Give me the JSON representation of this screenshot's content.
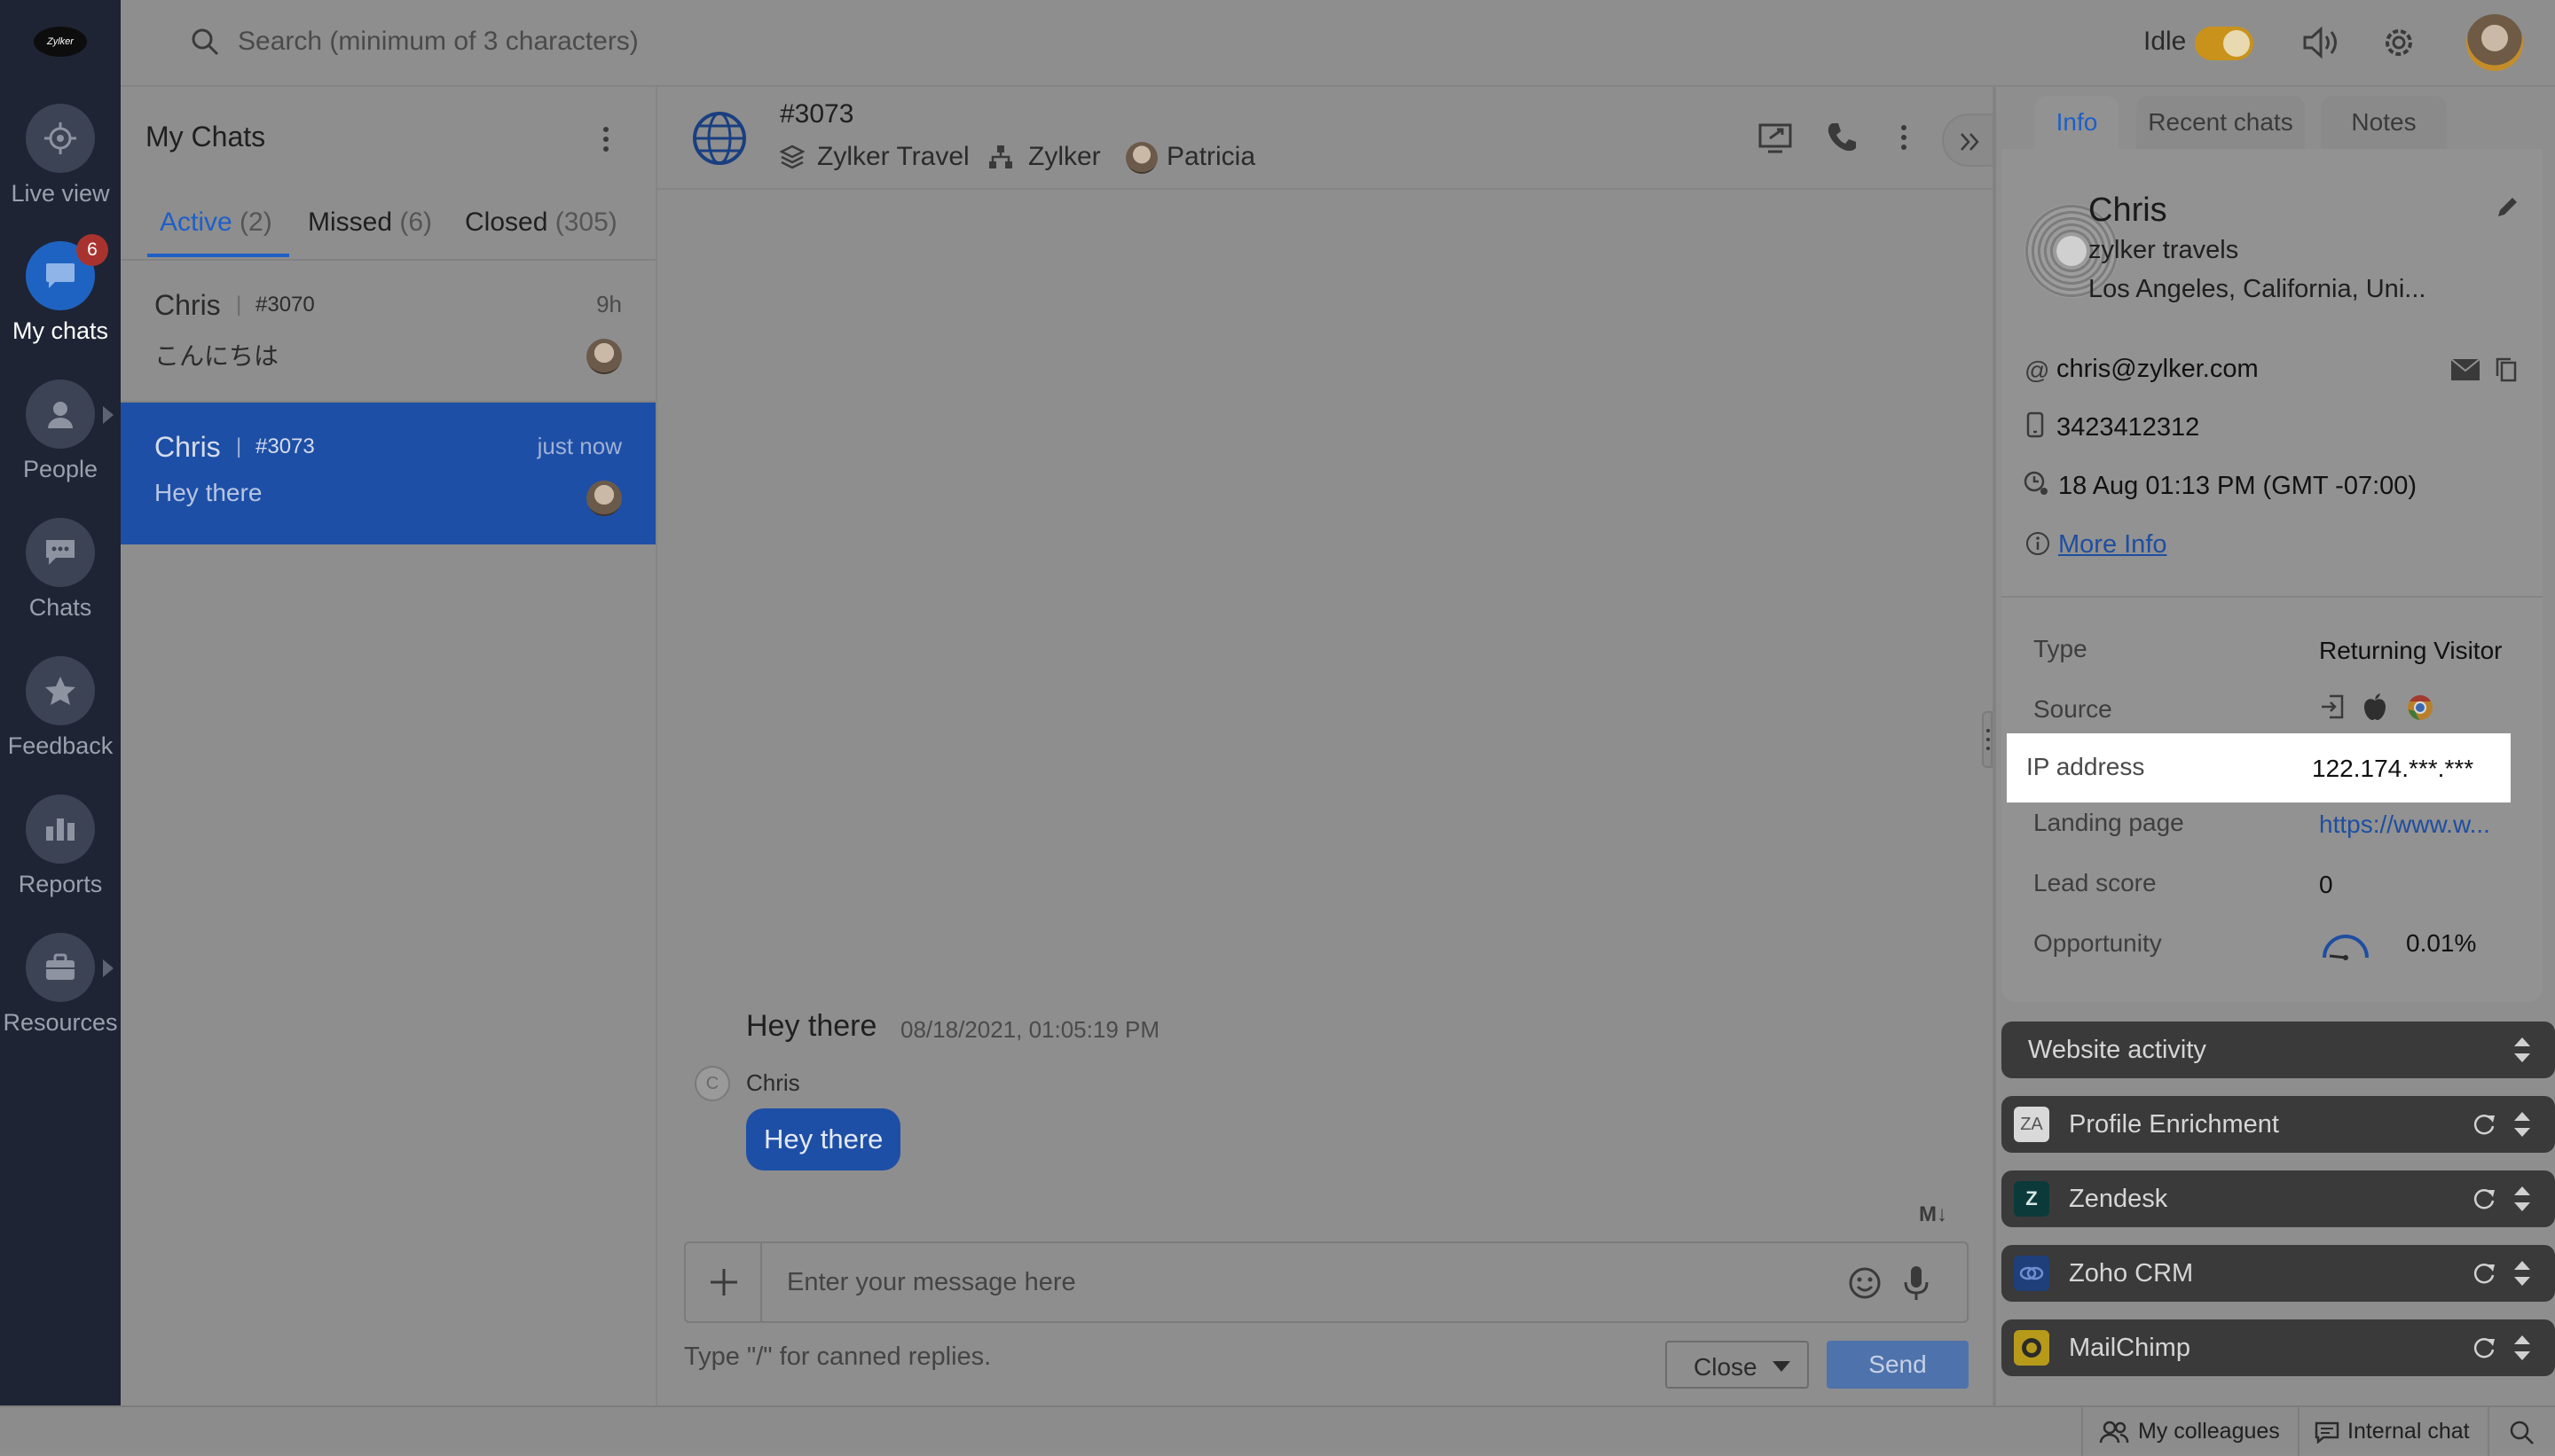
{
  "nav": {
    "logo": "Zylker",
    "items": [
      {
        "label": "Live view",
        "icon": "crosshair-icon"
      },
      {
        "label": "My chats",
        "icon": "chat-bubble-icon",
        "badge": "6"
      },
      {
        "label": "People",
        "icon": "person-icon"
      },
      {
        "label": "Chats",
        "icon": "chats-icon"
      },
      {
        "label": "Feedback",
        "icon": "star-icon"
      },
      {
        "label": "Reports",
        "icon": "bar-chart-icon"
      },
      {
        "label": "Resources",
        "icon": "briefcase-icon"
      }
    ]
  },
  "topbar": {
    "search_placeholder": "Search (minimum of 3 characters)",
    "status_label": "Idle",
    "toggle_color": "#d8a21a"
  },
  "chatlist": {
    "title": "My Chats",
    "tabs": [
      {
        "label": "Active",
        "count": "(2)"
      },
      {
        "label": "Missed",
        "count": "(6)"
      },
      {
        "label": "Closed",
        "count": "(305)"
      }
    ],
    "chats": [
      {
        "name": "Chris",
        "id": "#3070",
        "time": "9h",
        "message": "こんにちは"
      },
      {
        "name": "Chris",
        "id": "#3073",
        "time": "just now",
        "message": "Hey there"
      }
    ]
  },
  "conversation": {
    "title": "#3073",
    "department": "Zylker Travel",
    "brand": "Zylker",
    "agent": "Patricia",
    "message_text": "Hey there",
    "message_timestamp": "08/18/2021, 01:05:19 PM",
    "sender": "Chris",
    "bubble_text": "Hey there",
    "markdown_badge": "M↓",
    "input_placeholder": "Enter your message here",
    "canned_hint": "Type \"/\" for canned replies.",
    "close_label": "Close",
    "send_label": "Send"
  },
  "rightpanel": {
    "tabs": [
      "Info",
      "Recent chats",
      "Notes"
    ],
    "visitor": {
      "name": "Chris",
      "company": "zylker travels",
      "location": "Los Angeles, California, Uni...",
      "email": "chris@zylker.com",
      "phone": "3423412312",
      "local_time": "18 Aug 01:13 PM  (GMT -07:00)",
      "more_info": "More Info"
    },
    "details": [
      {
        "label": "Type",
        "value": "Returning Visitor"
      },
      {
        "label": "Source",
        "value": ""
      },
      {
        "label": "IP address",
        "value": "122.174.***.***"
      },
      {
        "label": "Landing page",
        "value": "https://www.w..."
      },
      {
        "label": "Lead score",
        "value": "0"
      },
      {
        "label": "Opportunity",
        "value": "0.01%"
      }
    ],
    "sections": [
      {
        "label": "Website activity",
        "icon": ""
      },
      {
        "label": "Profile Enrichment",
        "icon": "profile-enrichment-icon"
      },
      {
        "label": "Zendesk",
        "icon": "zendesk-icon"
      },
      {
        "label": "Zoho CRM",
        "icon": "zoho-crm-icon"
      },
      {
        "label": "MailChimp",
        "icon": "mailchimp-icon"
      }
    ]
  },
  "bottombar": {
    "colleagues": "My colleagues",
    "internal_chat": "Internal chat"
  }
}
